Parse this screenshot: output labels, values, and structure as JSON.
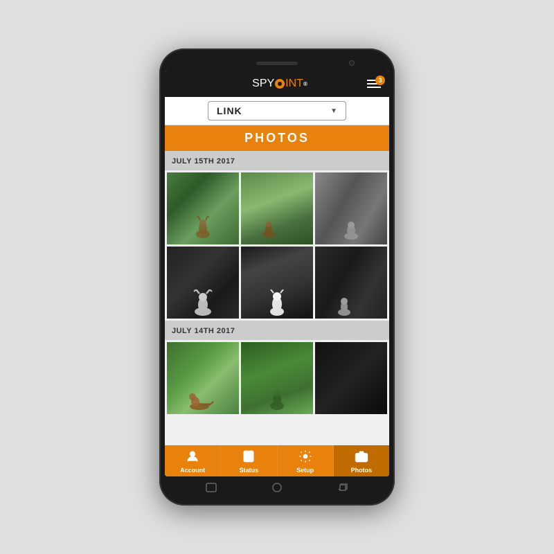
{
  "phone": {
    "speaker_aria": "speaker",
    "camera_aria": "front-camera"
  },
  "header": {
    "logo_spy": "SPY",
    "logo_point": "P",
    "logo_rest": "INT",
    "notification_count": "3",
    "menu_aria": "menu"
  },
  "device_selector": {
    "selected": "LINK",
    "dropdown_aria": "device dropdown"
  },
  "page_title": "PHOTOS",
  "sections": [
    {
      "date": "JULY 15TH 2017",
      "photos": [
        {
          "id": "p1",
          "type": "day-1",
          "aria": "deer in woods daytime"
        },
        {
          "id": "p2",
          "type": "day-2",
          "aria": "deer in woods daytime 2"
        },
        {
          "id": "p3",
          "type": "day-3",
          "aria": "deer grayscale"
        },
        {
          "id": "p4",
          "type": "night-1",
          "aria": "deer night vision buck"
        },
        {
          "id": "p5",
          "type": "night-2",
          "aria": "deer night vision white"
        },
        {
          "id": "p6",
          "type": "night-3",
          "aria": "deer night vision side"
        }
      ]
    },
    {
      "date": "JULY 14TH 2017",
      "photos": [
        {
          "id": "p7",
          "type": "day2-1",
          "aria": "deer running woods"
        },
        {
          "id": "p8",
          "type": "day2-2",
          "aria": "deer green woods"
        },
        {
          "id": "p9",
          "type": "dark-1",
          "aria": "very dark photo"
        }
      ]
    }
  ],
  "bottom_nav": [
    {
      "id": "account",
      "label": "Account",
      "icon": "person",
      "active": false
    },
    {
      "id": "status",
      "label": "Status",
      "icon": "list",
      "active": false
    },
    {
      "id": "setup",
      "label": "Setup",
      "icon": "gear",
      "active": false
    },
    {
      "id": "photos",
      "label": "Photos",
      "icon": "camera",
      "active": true
    }
  ],
  "phone_nav": {
    "back": "◁",
    "home": "○",
    "recent": "□"
  }
}
